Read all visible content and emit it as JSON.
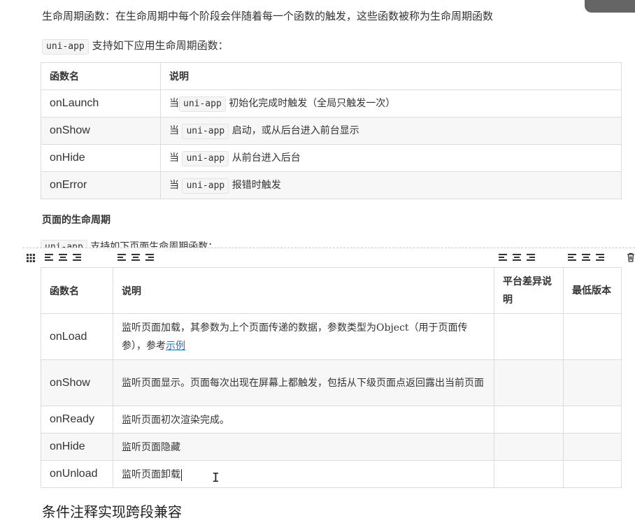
{
  "intro": {
    "line1": "生命周期函数：在生命周期中每个阶段会伴随着每一个函数的触发，这些函数被称为生命周期函数",
    "line2_code": "uni-app",
    "line2_text": " 支持如下应用生命周期函数："
  },
  "app_table": {
    "headers": [
      "函数名",
      "说明"
    ],
    "rows": [
      {
        "name": "onLaunch",
        "pre": "当",
        "code": "uni-app",
        "post": " 初始化完成时触发（全局只触发一次）"
      },
      {
        "name": "onShow",
        "pre": "当 ",
        "code": "uni-app",
        "post": " 启动，或从后台进入前台显示"
      },
      {
        "name": "onHide",
        "pre": "当 ",
        "code": "uni-app",
        "post": " 从前台进入后台"
      },
      {
        "name": "onError",
        "pre": "当 ",
        "code": "uni-app",
        "post": " 报错时触发"
      }
    ]
  },
  "page_section": {
    "heading": "页面的生命周期",
    "cut_code": "uni-app",
    "cut_text": " 支持如下页面生命周期函数："
  },
  "page_table": {
    "headers": [
      "函数名",
      "说明",
      "平台差异说明",
      "最低版本"
    ],
    "rows": [
      {
        "name": "onLoad",
        "desc": "监听页面加载，其参数为上个页面传递的数据，参数类型为Object（用于页面传参），参考",
        "link": "示例"
      },
      {
        "name": "onShow",
        "desc": "监听页面显示。页面每次出现在屏幕上都触发，包括从下级页面点返回露出当前页面",
        "link": ""
      },
      {
        "name": "onReady",
        "desc": "监听页面初次渲染完成。",
        "link": ""
      },
      {
        "name": "onHide",
        "desc": "监听页面隐藏",
        "link": ""
      },
      {
        "name": "onUnload",
        "desc": "监听页面卸载",
        "link": ""
      }
    ]
  },
  "footer": {
    "heading": "条件注释实现跨段兼容"
  },
  "icons": {
    "grid": "grid-icon",
    "align": "align-icon",
    "trash": "trash-icon"
  }
}
